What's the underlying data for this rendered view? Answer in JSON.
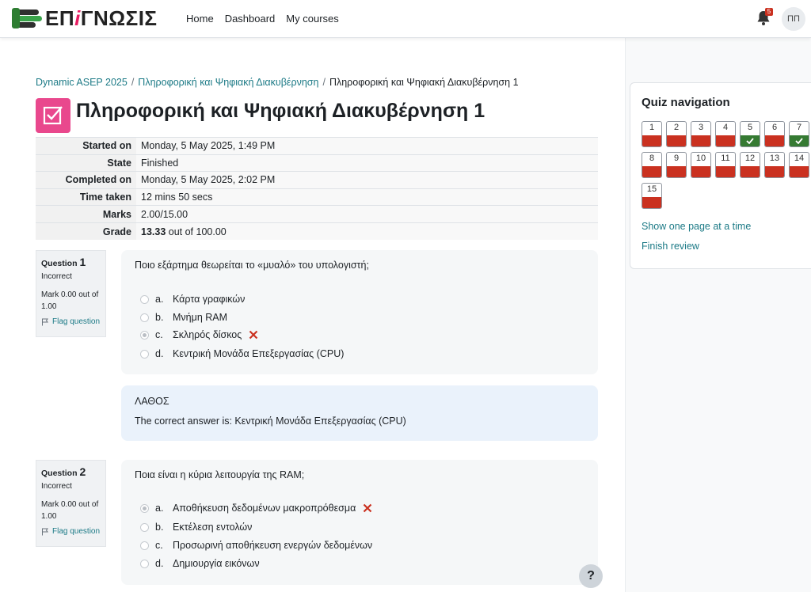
{
  "navbar": {
    "logo_text_pre": "ΕΠ",
    "logo_text_i": "i",
    "logo_text_post": "ΓΝΩΣΙΣ",
    "links": [
      "Home",
      "Dashboard",
      "My courses"
    ],
    "notification_count": "5",
    "avatar_initials": "ΠΠ",
    "icons": {
      "notifications": "bell-icon"
    }
  },
  "breadcrumb": {
    "items": [
      "Dynamic ASEP 2025",
      "Πληροφορική και Ψηφιακή Διακυβέρνηση",
      "Πληροφορική και Ψηφιακή Διακυβέρνηση 1"
    ],
    "separator": "/"
  },
  "page": {
    "title": "Πληροφορική και Ψηφιακή Διακυβέρνηση 1",
    "icon": "quiz-icon",
    "icon_color": "#e9488d"
  },
  "summary": {
    "rows": [
      {
        "label": "Started on",
        "value": "Monday, 5 May 2025, 1:49 PM"
      },
      {
        "label": "State",
        "value": "Finished"
      },
      {
        "label": "Completed on",
        "value": "Monday, 5 May 2025, 2:02 PM"
      },
      {
        "label": "Time taken",
        "value": "12 mins 50 secs"
      },
      {
        "label": "Marks",
        "value": "2.00/15.00"
      }
    ],
    "grade_label": "Grade",
    "grade_value": "13.33",
    "grade_suffix": " out of 100.00"
  },
  "questions": [
    {
      "label": "Question",
      "number": "1",
      "state": "Incorrect",
      "grade": "Mark 0.00 out of 1.00",
      "flag_label": "Flag question",
      "text": "Ποιο εξάρτημα θεωρείται το «μυαλό» του υπολογιστή;",
      "answers": [
        {
          "letter": "a.",
          "text": "Κάρτα γραφικών",
          "selected": false,
          "mark": ""
        },
        {
          "letter": "b.",
          "text": "Μνήμη RAM",
          "selected": false,
          "mark": ""
        },
        {
          "letter": "c.",
          "text": "Σκληρός δίσκος",
          "selected": true,
          "mark": "incorrect"
        },
        {
          "letter": "d.",
          "text": "Κεντρική Μονάδα Επεξεργασίας (CPU)",
          "selected": false,
          "mark": ""
        }
      ],
      "feedback_general": "ΛΑΘΟΣ",
      "feedback_right": "The correct answer is: Κεντρική Μονάδα Επεξεργασίας (CPU)"
    },
    {
      "label": "Question",
      "number": "2",
      "state": "Incorrect",
      "grade": "Mark 0.00 out of 1.00",
      "flag_label": "Flag question",
      "text": "Ποια είναι η κύρια λειτουργία της RAM;",
      "answers": [
        {
          "letter": "a.",
          "text": "Αποθήκευση δεδομένων μακροπρόθεσμα",
          "selected": true,
          "mark": "incorrect"
        },
        {
          "letter": "b.",
          "text": "Εκτέλεση εντολών",
          "selected": false,
          "mark": ""
        },
        {
          "letter": "c.",
          "text": "Προσωρινή αποθήκευση ενεργών δεδομένων",
          "selected": false,
          "mark": ""
        },
        {
          "letter": "d.",
          "text": "Δημιουργία εικόνων",
          "selected": false,
          "mark": ""
        }
      ]
    }
  ],
  "quiz_navigation": {
    "title": "Quiz navigation",
    "buttons": [
      {
        "number": "1",
        "state": "incorrect"
      },
      {
        "number": "2",
        "state": "incorrect"
      },
      {
        "number": "3",
        "state": "incorrect"
      },
      {
        "number": "4",
        "state": "incorrect"
      },
      {
        "number": "5",
        "state": "correct"
      },
      {
        "number": "6",
        "state": "incorrect"
      },
      {
        "number": "7",
        "state": "correct"
      },
      {
        "number": "8",
        "state": "incorrect"
      },
      {
        "number": "9",
        "state": "incorrect"
      },
      {
        "number": "10",
        "state": "incorrect"
      },
      {
        "number": "11",
        "state": "incorrect"
      },
      {
        "number": "12",
        "state": "incorrect"
      },
      {
        "number": "13",
        "state": "incorrect"
      },
      {
        "number": "14",
        "state": "incorrect"
      },
      {
        "number": "15",
        "state": "incorrect"
      }
    ],
    "show_one_page": "Show one page at a time",
    "finish_review": "Finish review"
  },
  "help": {
    "label": "?"
  },
  "colors": {
    "link": "#1c7a86",
    "incorrect": "#ca3120",
    "correct": "#357a32",
    "feedback_bg": "#eaf2fb"
  }
}
